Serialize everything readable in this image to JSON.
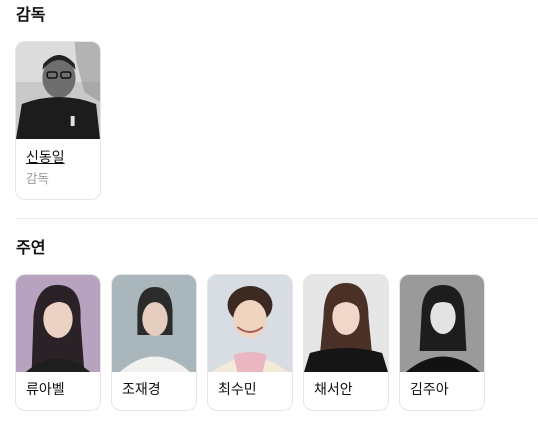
{
  "director_section": {
    "title": "감독",
    "people": [
      {
        "name": "신동일",
        "role": "감독"
      }
    ]
  },
  "cast_section": {
    "title": "주연",
    "people": [
      {
        "name": "류아벨"
      },
      {
        "name": "조재경"
      },
      {
        "name": "최수민"
      },
      {
        "name": "채서안"
      },
      {
        "name": "김주아"
      }
    ]
  }
}
